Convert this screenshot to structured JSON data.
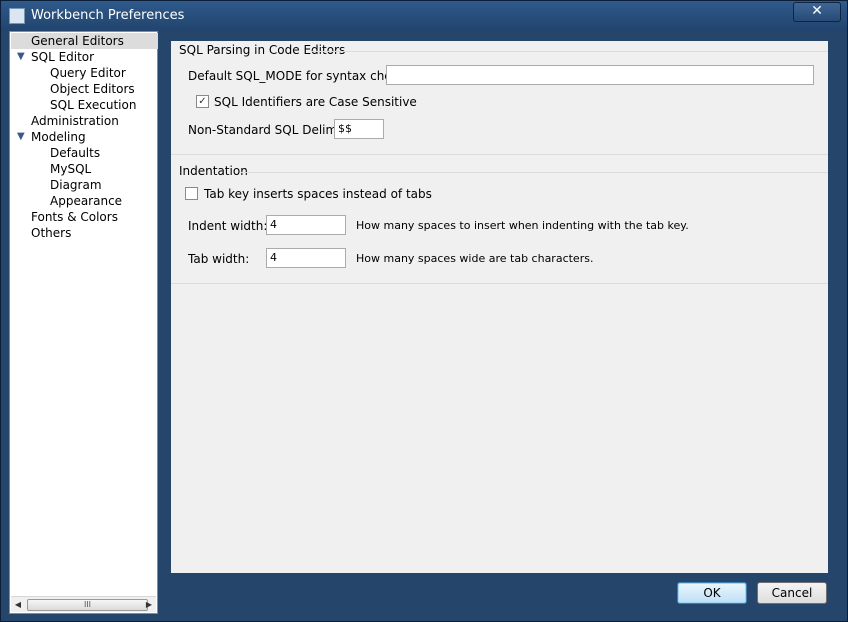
{
  "window": {
    "title": "Workbench Preferences",
    "close_glyph": "✕"
  },
  "sidebar": {
    "items": [
      {
        "label": "General Editors",
        "selected": true
      },
      {
        "label": "SQL Editor",
        "expandable": true,
        "icon": "triangle-down-icon"
      },
      {
        "label": "Query Editor"
      },
      {
        "label": "Object Editors"
      },
      {
        "label": "SQL Execution"
      },
      {
        "label": "Administration"
      },
      {
        "label": "Modeling",
        "expandable": true,
        "icon": "triangle-down-icon"
      },
      {
        "label": "Defaults"
      },
      {
        "label": "MySQL"
      },
      {
        "label": "Diagram"
      },
      {
        "label": "Appearance"
      },
      {
        "label": "Fonts & Colors"
      },
      {
        "label": "Others"
      }
    ],
    "scroll_left": "◀",
    "scroll_right": "▶",
    "thumb_grip": "III"
  },
  "sql_parsing": {
    "title": "SQL Parsing in Code Editors",
    "sql_mode_label": "Default SQL_MODE for syntax checker:",
    "sql_mode_value": "",
    "case_sensitive_label": "SQL Identifiers are Case Sensitive",
    "case_sensitive_checked": true,
    "check_glyph": "✓",
    "delimiter_label": "Non-Standard SQL Delimiter:",
    "delimiter_value": "$$"
  },
  "indentation": {
    "title": "Indentation",
    "tab_spaces_label": "Tab key inserts spaces instead of tabs",
    "tab_spaces_checked": false,
    "indent_width_label": "Indent width:",
    "indent_width_value": "4",
    "indent_width_help": "How many spaces to insert when indenting with the tab key.",
    "tab_width_label": "Tab width:",
    "tab_width_value": "4",
    "tab_width_help": "How many spaces wide are tab characters."
  },
  "footer": {
    "ok_label": "OK",
    "cancel_label": "Cancel"
  },
  "colors": {
    "frame": "#26456b",
    "panel": "#f0f0f0",
    "tree_toggle": "#3b5a85",
    "default_button": "#bfe0f5"
  }
}
